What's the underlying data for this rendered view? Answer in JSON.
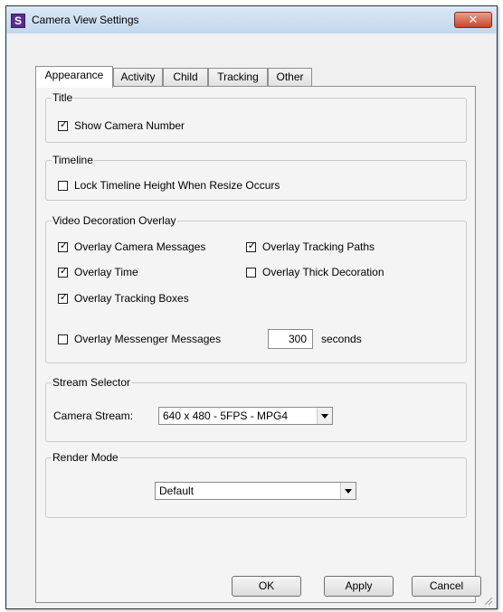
{
  "window": {
    "title": "Camera View Settings",
    "app_icon_letter": "S",
    "close_glyph": "✕"
  },
  "tabs": [
    {
      "label": "Appearance",
      "active": true
    },
    {
      "label": "Activity",
      "active": false
    },
    {
      "label": "Child",
      "active": false
    },
    {
      "label": "Tracking",
      "active": false
    },
    {
      "label": "Other",
      "active": false
    }
  ],
  "title_group": {
    "legend": "Title",
    "show_camera_number": {
      "label": "Show Camera Number",
      "checked": true
    }
  },
  "timeline_group": {
    "legend": "Timeline",
    "lock_timeline": {
      "label": "Lock Timeline Height When Resize Occurs",
      "checked": false
    }
  },
  "overlay_group": {
    "legend": "Video Decoration Overlay",
    "camera_messages": {
      "label": "Overlay Camera Messages",
      "checked": true
    },
    "tracking_paths": {
      "label": "Overlay Tracking Paths",
      "checked": true
    },
    "time": {
      "label": "Overlay Time",
      "checked": true
    },
    "thick_decoration": {
      "label": "Overlay Thick Decoration",
      "checked": false
    },
    "tracking_boxes": {
      "label": "Overlay Tracking Boxes",
      "checked": true
    },
    "messenger_messages": {
      "label": "Overlay Messenger Messages",
      "checked": false
    },
    "seconds_value": "300",
    "seconds_label": "seconds"
  },
  "stream_group": {
    "legend": "Stream Selector",
    "camera_stream_label": "Camera Stream:",
    "camera_stream_value": "640 x 480 - 5FPS - MPG4"
  },
  "render_group": {
    "legend": "Render Mode",
    "value": "Default"
  },
  "buttons": {
    "ok": "OK",
    "apply": "Apply",
    "cancel": "Cancel"
  },
  "check_glyph": "✓"
}
